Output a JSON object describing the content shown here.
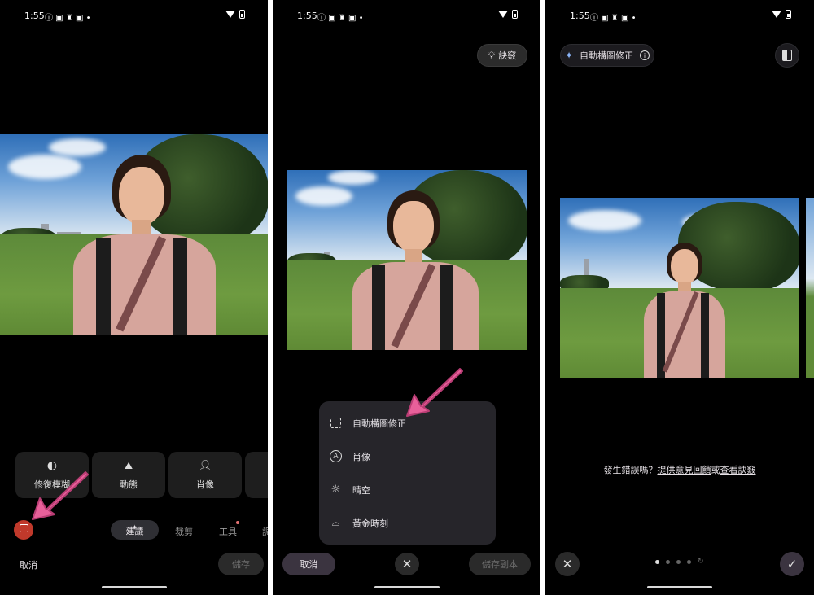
{
  "status": {
    "time": "1:55",
    "left_icons": "ⓘ ▣ ♜ ▣ •"
  },
  "panel1": {
    "tiles": [
      {
        "label": "修復模糊",
        "icon": "half-circle-icon"
      },
      {
        "label": "動態",
        "icon": "mountain-icon"
      },
      {
        "label": "肖像",
        "icon": "person-icon"
      }
    ],
    "tabs": {
      "suggest": "建議",
      "crop": "裁剪",
      "tools": "工具",
      "more": "調"
    },
    "cancel": "取消",
    "save": "儲存",
    "accent": "#c0392b"
  },
  "panel2": {
    "tips": "訣竅",
    "menu": [
      {
        "label": "自動構圖修正",
        "icon": "frame-icon"
      },
      {
        "label": "肖像",
        "icon": "portrait-icon"
      },
      {
        "label": "晴空",
        "icon": "sun-icon"
      },
      {
        "label": "黃金時刻",
        "icon": "sunset-icon"
      }
    ],
    "cancel": "取消",
    "save_copy": "儲存副本"
  },
  "panel3": {
    "title": "自動構圖修正",
    "feedback_prefix": "發生錯誤嗎？",
    "feedback_link": "提供意見回饋",
    "feedback_mid": "或",
    "tips_link": "查看訣竅"
  },
  "colors": {
    "arrow": "#e8609a",
    "menu_bg": "#26252a",
    "pill_bg": "#3a3a3e"
  }
}
